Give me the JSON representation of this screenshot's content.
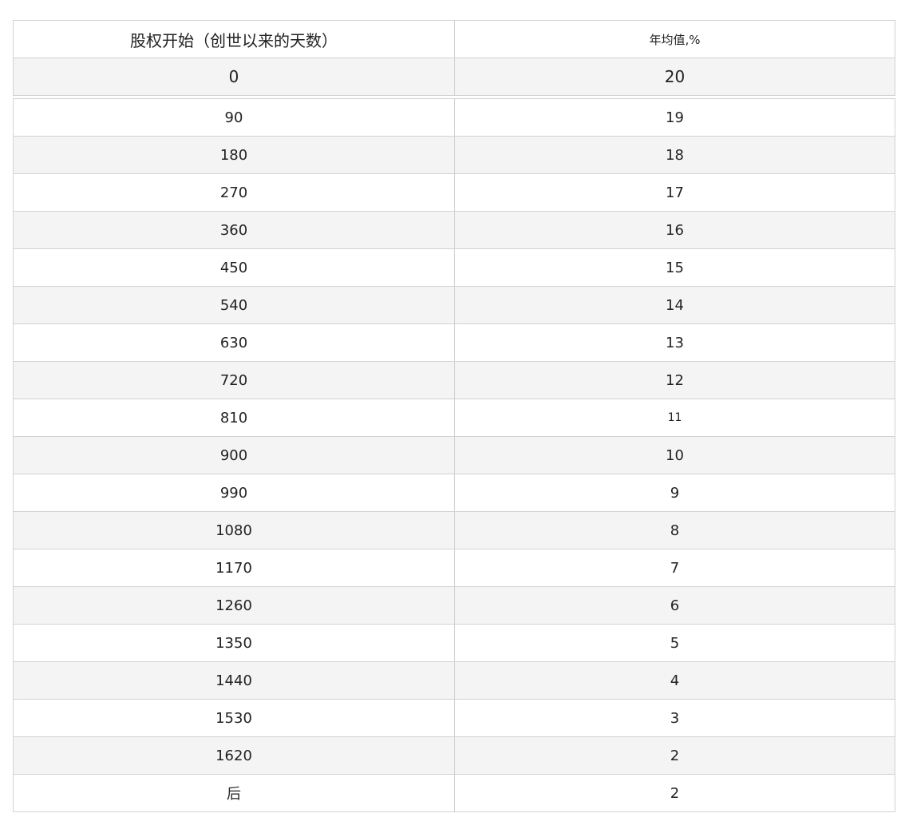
{
  "table": {
    "headers": [
      "股权开始（创世以来的天数）",
      "年均值,%"
    ],
    "first_row": [
      "0",
      "20"
    ],
    "rows": [
      [
        "90",
        "19"
      ],
      [
        "180",
        "18"
      ],
      [
        "270",
        "17"
      ],
      [
        "360",
        "16"
      ],
      [
        "450",
        "15"
      ],
      [
        "540",
        "14"
      ],
      [
        "630",
        "13"
      ],
      [
        "720",
        "12"
      ],
      [
        "810",
        "11"
      ],
      [
        "900",
        "10"
      ],
      [
        "990",
        "9"
      ],
      [
        "1080",
        "8"
      ],
      [
        "1170",
        "7"
      ],
      [
        "1260",
        "6"
      ],
      [
        "1350",
        "5"
      ],
      [
        "1440",
        "4"
      ],
      [
        "1530",
        "3"
      ],
      [
        "1620",
        "2"
      ],
      [
        "后",
        "2"
      ]
    ]
  }
}
